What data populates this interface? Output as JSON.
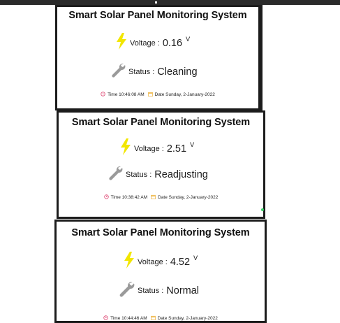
{
  "panels": [
    {
      "title": "Smart Solar Panel Monitoring System",
      "voltage_label": "Voltage :",
      "voltage_value": "0.16",
      "voltage_unit": "V",
      "status_label": "Status :",
      "status_value": "Cleaning",
      "time_text": "Time 10:46:08 AM",
      "date_text": "Date Sunday, 2-January-2022"
    },
    {
      "title": "Smart Solar Panel Monitoring System",
      "voltage_label": "Voltage :",
      "voltage_value": "2.51",
      "voltage_unit": "V",
      "status_label": "Status :",
      "status_value": "Readjusting",
      "time_text": "Time 10:38:42 AM",
      "date_text": "Date Sunday, 2-January-2022"
    },
    {
      "title": "Smart Solar Panel Monitoring System",
      "voltage_label": "Voltage :",
      "voltage_value": "4.52",
      "voltage_unit": "V",
      "status_label": "Status :",
      "status_value": "Normal",
      "time_text": "Time 10:44:46 AM",
      "date_text": "Date Sunday, 2-January-2022"
    }
  ],
  "icons": {
    "voltage": "lightning-bolt-icon",
    "status": "wrench-icon",
    "time": "clock-icon",
    "date": "calendar-icon"
  },
  "colors": {
    "bolt": "#f2e600",
    "wrench": "#9a9a9a",
    "clock": "#e0507a",
    "calendar": "#f0c060",
    "border": "#1c1c1c"
  }
}
